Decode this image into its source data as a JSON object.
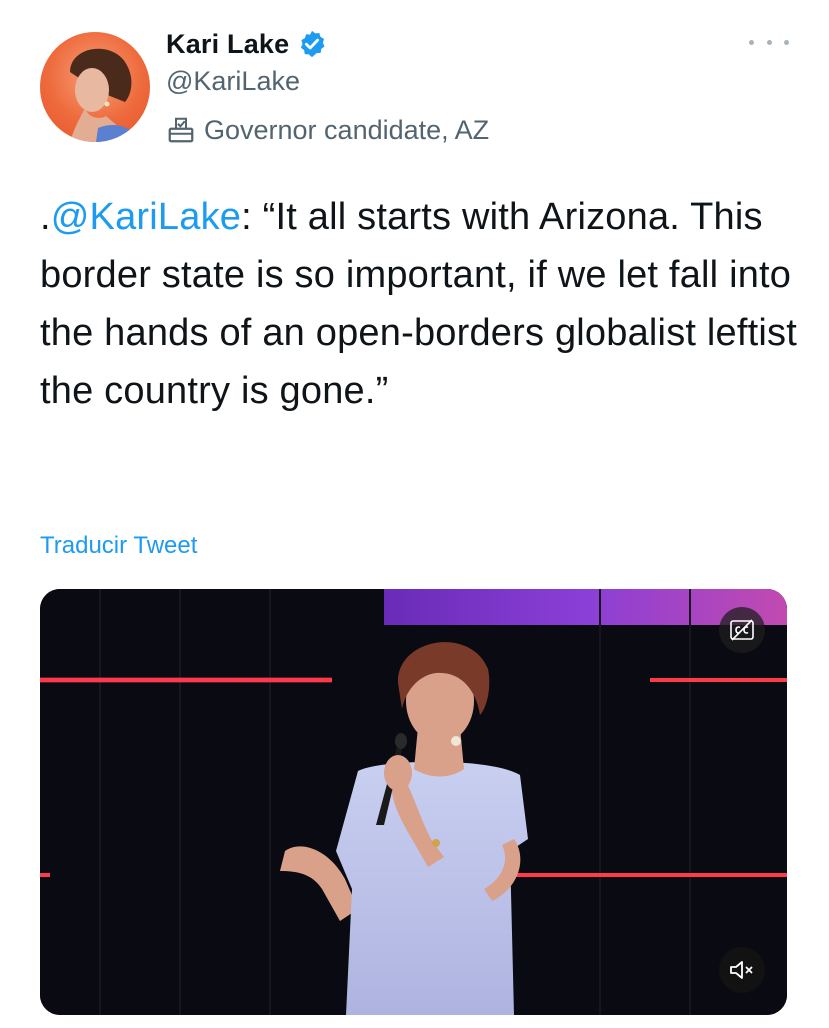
{
  "author": {
    "display_name": "Kari Lake",
    "handle": "@KariLake",
    "label": "Governor candidate, AZ",
    "verified_icon": "verified-badge-icon",
    "label_icon": "ballot-box-icon"
  },
  "tweet": {
    "prefix": ".",
    "mention": "@KariLake",
    "body": ": “It all starts with Arizona. This border state is so important, if we let fall into the hands of an open-borders globalist leftist the country is gone.”",
    "translate_label": "Traducir Tweet"
  },
  "media": {
    "type": "video",
    "cc_icon": "closed-captions-icon",
    "mute_icon": "muted-speaker-icon"
  },
  "colors": {
    "accent": "#1d9bf0",
    "text": "#0f1419",
    "secondary": "#536471"
  }
}
